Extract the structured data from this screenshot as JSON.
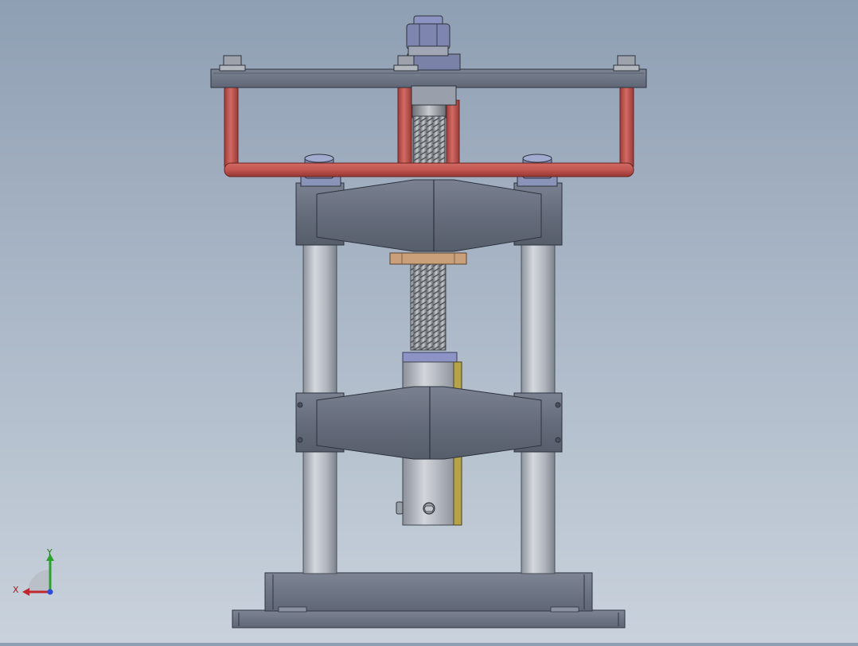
{
  "window": {
    "title": ""
  },
  "triad": {
    "x_label": "X",
    "y_label": "Y",
    "x_color": "#c0282d",
    "y_color": "#2ca02c",
    "z_color": "#2a4bd7"
  },
  "model": {
    "frame_color": "#6b7383",
    "rod_color": "#b9bec6",
    "handle_color": "#c15550",
    "screw_color": "#9ea1a5",
    "bushing_color": "#c9a07a",
    "accent_color": "#b5a34a"
  }
}
